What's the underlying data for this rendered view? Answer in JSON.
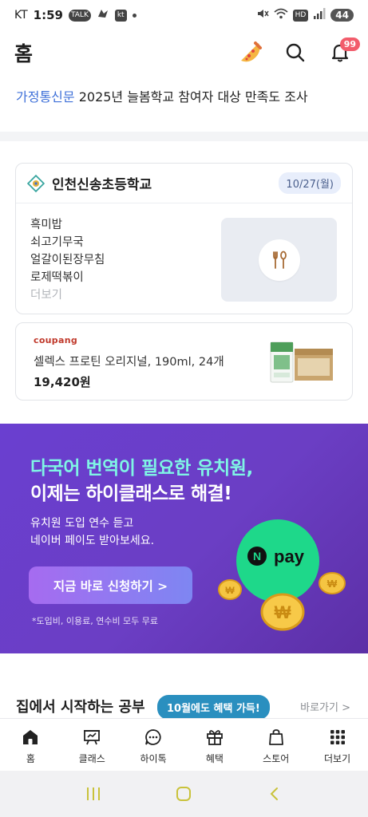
{
  "status_bar": {
    "carrier": "KT",
    "time": "1:59",
    "icon_talk": "TALK",
    "icon_kt": "kt",
    "icon_hd": "HD",
    "battery": "44"
  },
  "header": {
    "title": "홈",
    "notification_count": "99"
  },
  "notice": {
    "tag": "가정통신문",
    "text": "2025년 늘봄학교 참여자 대상 만족도 조사"
  },
  "lunch": {
    "school_name": "인천신송초등학교",
    "date": "10/27(월)",
    "menu": [
      "흑미밥",
      "쇠고기무국",
      "얼갈이된장무침",
      "로제떡볶이"
    ],
    "more": "더보기"
  },
  "ad": {
    "brand": "coupang",
    "title": "셀렉스 프로틴 오리지널, 190ml, 24개",
    "price": "19,420원"
  },
  "banner": {
    "line1": "다국어 번역이 필요한 유치원,",
    "line2": "이제는 하이클래스로 해결!",
    "sub1": "유치원 도입 연수 듣고",
    "sub2": "네이버 페이도 받아보세요.",
    "cta": "지금 바로 신청하기 >",
    "note": "*도입비, 이용료, 연수비 모두 무료",
    "npay": "pay"
  },
  "section": {
    "title": "집에서 시작하는 공부",
    "link": "바로가기 >"
  },
  "tooltip": "10월에도 혜택 가득!",
  "bottom_nav": [
    {
      "label": "홈",
      "icon": "home-icon"
    },
    {
      "label": "클래스",
      "icon": "class-icon"
    },
    {
      "label": "하이톡",
      "icon": "chat-icon"
    },
    {
      "label": "혜택",
      "icon": "gift-icon"
    },
    {
      "label": "스토어",
      "icon": "shopping-bag-icon"
    },
    {
      "label": "더보기",
      "icon": "grid-icon"
    }
  ],
  "colors": {
    "accent_blue": "#3d6fd8",
    "badge_red": "#f25c6b",
    "banner_purple": "#6a3fd0",
    "banner_mint": "#7ff5e5",
    "tooltip_blue": "#2a8fbf"
  }
}
